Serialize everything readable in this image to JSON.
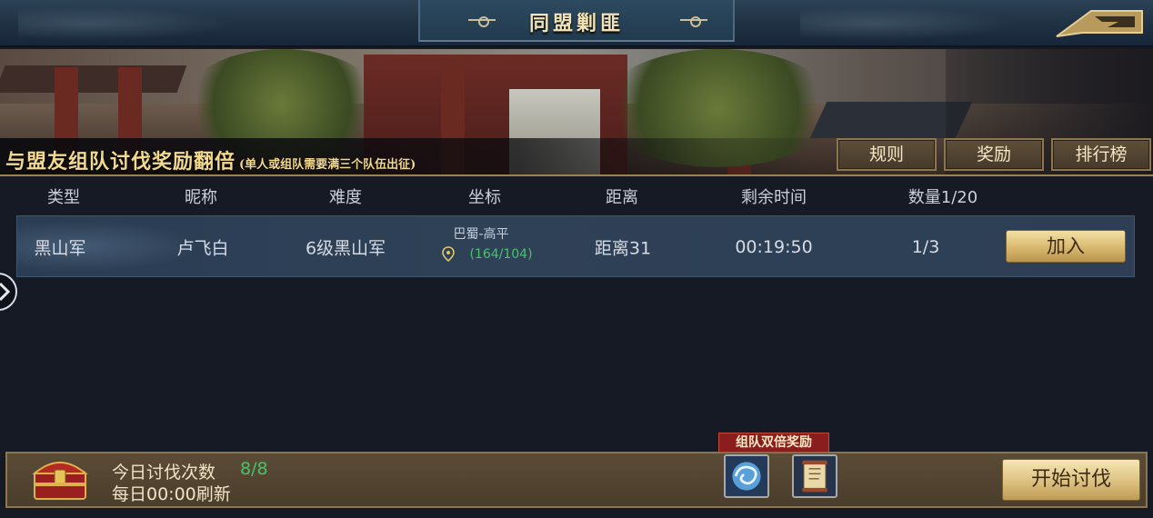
{
  "header": {
    "title": "同盟剿匪"
  },
  "banner": {
    "promo_title": "与盟友组队讨伐奖励翻倍",
    "promo_note": "(单人或组队需要满三个队伍出征)",
    "buttons": {
      "rules": "规则",
      "rewards": "奖励",
      "ranking": "排行榜"
    }
  },
  "table": {
    "headers": [
      "类型",
      "昵称",
      "难度",
      "坐标",
      "距离",
      "剩余时间",
      "数量1/20"
    ],
    "rows": [
      {
        "type": "黑山军",
        "nickname": "卢飞白",
        "difficulty": "6级黑山军",
        "location_name": "巴蜀-高平",
        "coordinates": "(164/104)",
        "distance": "距离31",
        "time_left": "00:19:50",
        "count": "1/3",
        "join_label": "加入"
      }
    ]
  },
  "footer": {
    "today_count_label": "今日讨伐次数",
    "today_count_value": "8/8",
    "refresh_note": "每日00:00刷新",
    "bonus_tag": "组队双倍奖励",
    "start_label": "开始讨伐"
  },
  "colors": {
    "accent_gold": "#f2d98e",
    "positive_green": "#47c36a",
    "row_bg": "#2f4157",
    "bonus_red": "#8a1e1e"
  },
  "icons": [
    "back-arrow-icon",
    "location-pin-icon",
    "expand-arrow-icon",
    "treasure-chest-icon",
    "swirl-orb-icon",
    "scroll-icon"
  ]
}
